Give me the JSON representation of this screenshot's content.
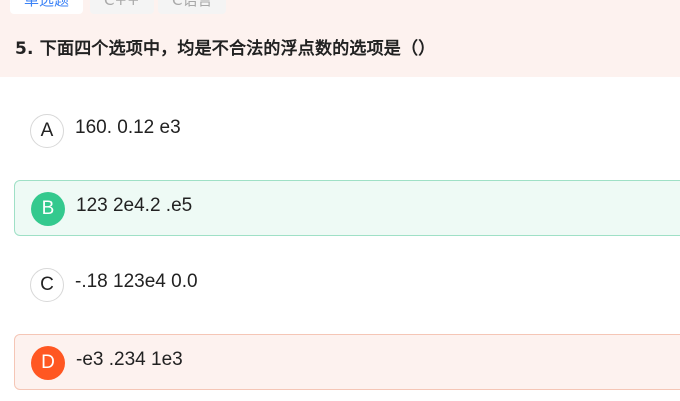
{
  "tags": [
    "单选题",
    "C++",
    "C语言"
  ],
  "question": {
    "text": "5. 下面四个选项中，均是不合法的浮点数的选项是（）"
  },
  "options": [
    {
      "letter": "A",
      "text": "160. 0.12 e3",
      "state": "normal"
    },
    {
      "letter": "B",
      "text": "123 2e4.2 .e5",
      "state": "correct"
    },
    {
      "letter": "C",
      "text": "-.18 123e4 0.0",
      "state": "normal"
    },
    {
      "letter": "D",
      "text": "-e3 .234 1e3",
      "state": "wrong"
    }
  ],
  "colors": {
    "header_bg": "#fdf2ef",
    "correct": "#34c98e",
    "wrong": "#ff5722",
    "tag_active": "#3b82f6"
  }
}
